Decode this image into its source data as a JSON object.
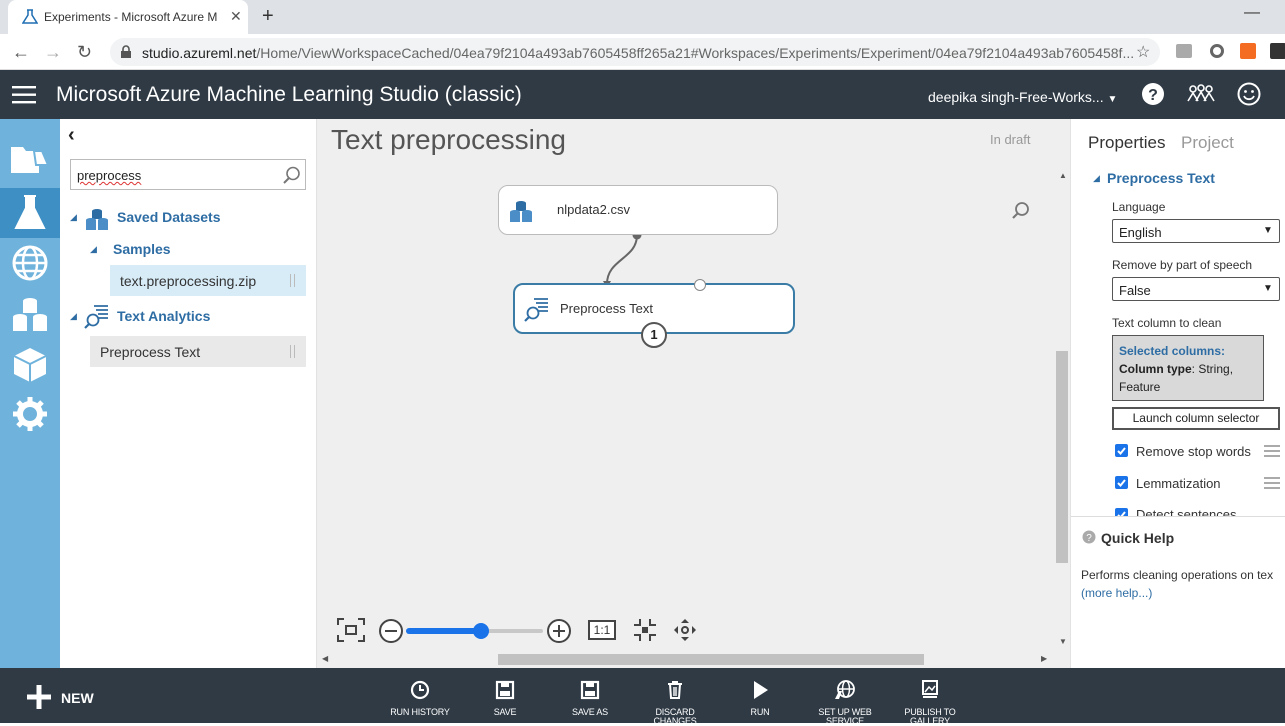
{
  "browser": {
    "tab_title": "Experiments - Microsoft Azure M",
    "url_host": "studio.azureml.net",
    "url_rest": "/Home/ViewWorkspaceCached/04ea79f2104a493ab7605458ff265a21#Workspaces/Experiments/Experiment/04ea79f2104a493ab7605458f..."
  },
  "app": {
    "title": "Microsoft Azure Machine Learning Studio (classic)",
    "user": "deepika singh-Free-Works..."
  },
  "palette": {
    "search_value": "preprocess",
    "saved_datasets": "Saved Datasets",
    "samples": "Samples",
    "sample_item": "text.preprocessing.zip",
    "text_analytics": "Text Analytics",
    "text_item": "Preprocess Text"
  },
  "canvas": {
    "experiment_title": "Text preprocessing",
    "status": "In draft",
    "module1": "nlpdata2.csv",
    "module2": "Preprocess Text",
    "module2_badge": "1",
    "zoom_level": 0.55,
    "zoom_reset_label": "1:1"
  },
  "properties": {
    "tab_properties": "Properties",
    "tab_project": "Project",
    "section": "Preprocess Text",
    "language_label": "Language",
    "language_value": "English",
    "pos_label": "Remove by part of speech",
    "pos_value": "False",
    "column_label": "Text column to clean",
    "selected_columns": "Selected columns:",
    "column_type_key": "Column type",
    "column_type_value": ": String, Feature",
    "launch_button": "Launch column selector",
    "check1": "Remove stop words",
    "check2": "Lemmatization",
    "check3": "Detect sentences",
    "quick_help": "Quick Help",
    "help_text": "Performs cleaning operations on tex",
    "more_help": "(more help...)"
  },
  "toolbar": {
    "new": "NEW",
    "run_history": "RUN HISTORY",
    "save": "SAVE",
    "save_as": "SAVE AS",
    "discard": "DISCARD CHANGES",
    "run": "RUN",
    "web_service_1": "SET UP WEB",
    "web_service_2": "SERVICE",
    "publish_1": "PUBLISH TO",
    "publish_2": "GALLERY"
  },
  "colors": {
    "header": "#2f3a45",
    "rail": "#6fb3dc",
    "accent": "#2e6da4",
    "module_border": "#3a7ca5"
  }
}
